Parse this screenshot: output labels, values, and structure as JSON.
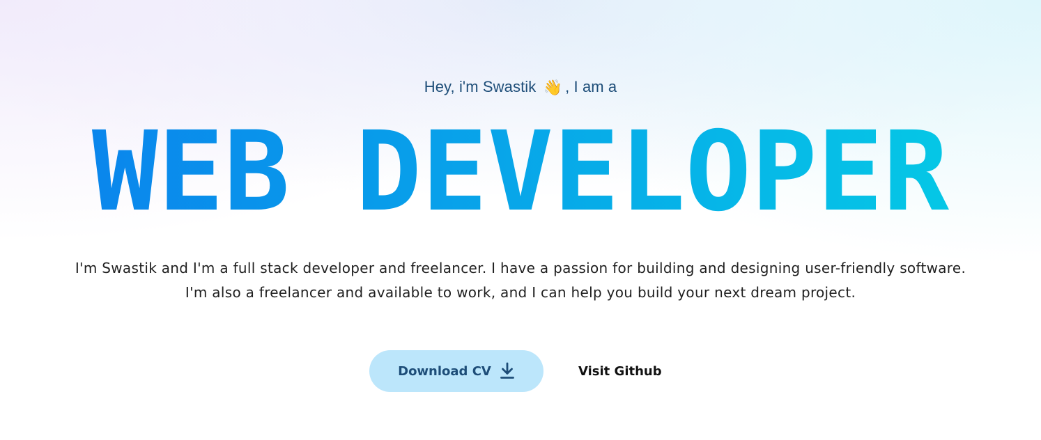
{
  "hero": {
    "greeting_prefix": "Hey, i'm Swastik",
    "greeting_emoji": "👋",
    "greeting_suffix": ", I am a",
    "headline": "WEB DEVELOPER",
    "headline_gradient": [
      "#0a86ec",
      "#05c7e6"
    ],
    "intro_line_1": "I'm Swastik and I'm a full stack developer and freelancer. I have a passion for building and designing user-friendly software.",
    "intro_line_2": "I'm also a freelancer and available to work, and I can help you build your next dream project."
  },
  "actions": {
    "download_cv_label": "Download CV",
    "download_icon": "download-icon",
    "visit_github_label": "Visit Github"
  }
}
